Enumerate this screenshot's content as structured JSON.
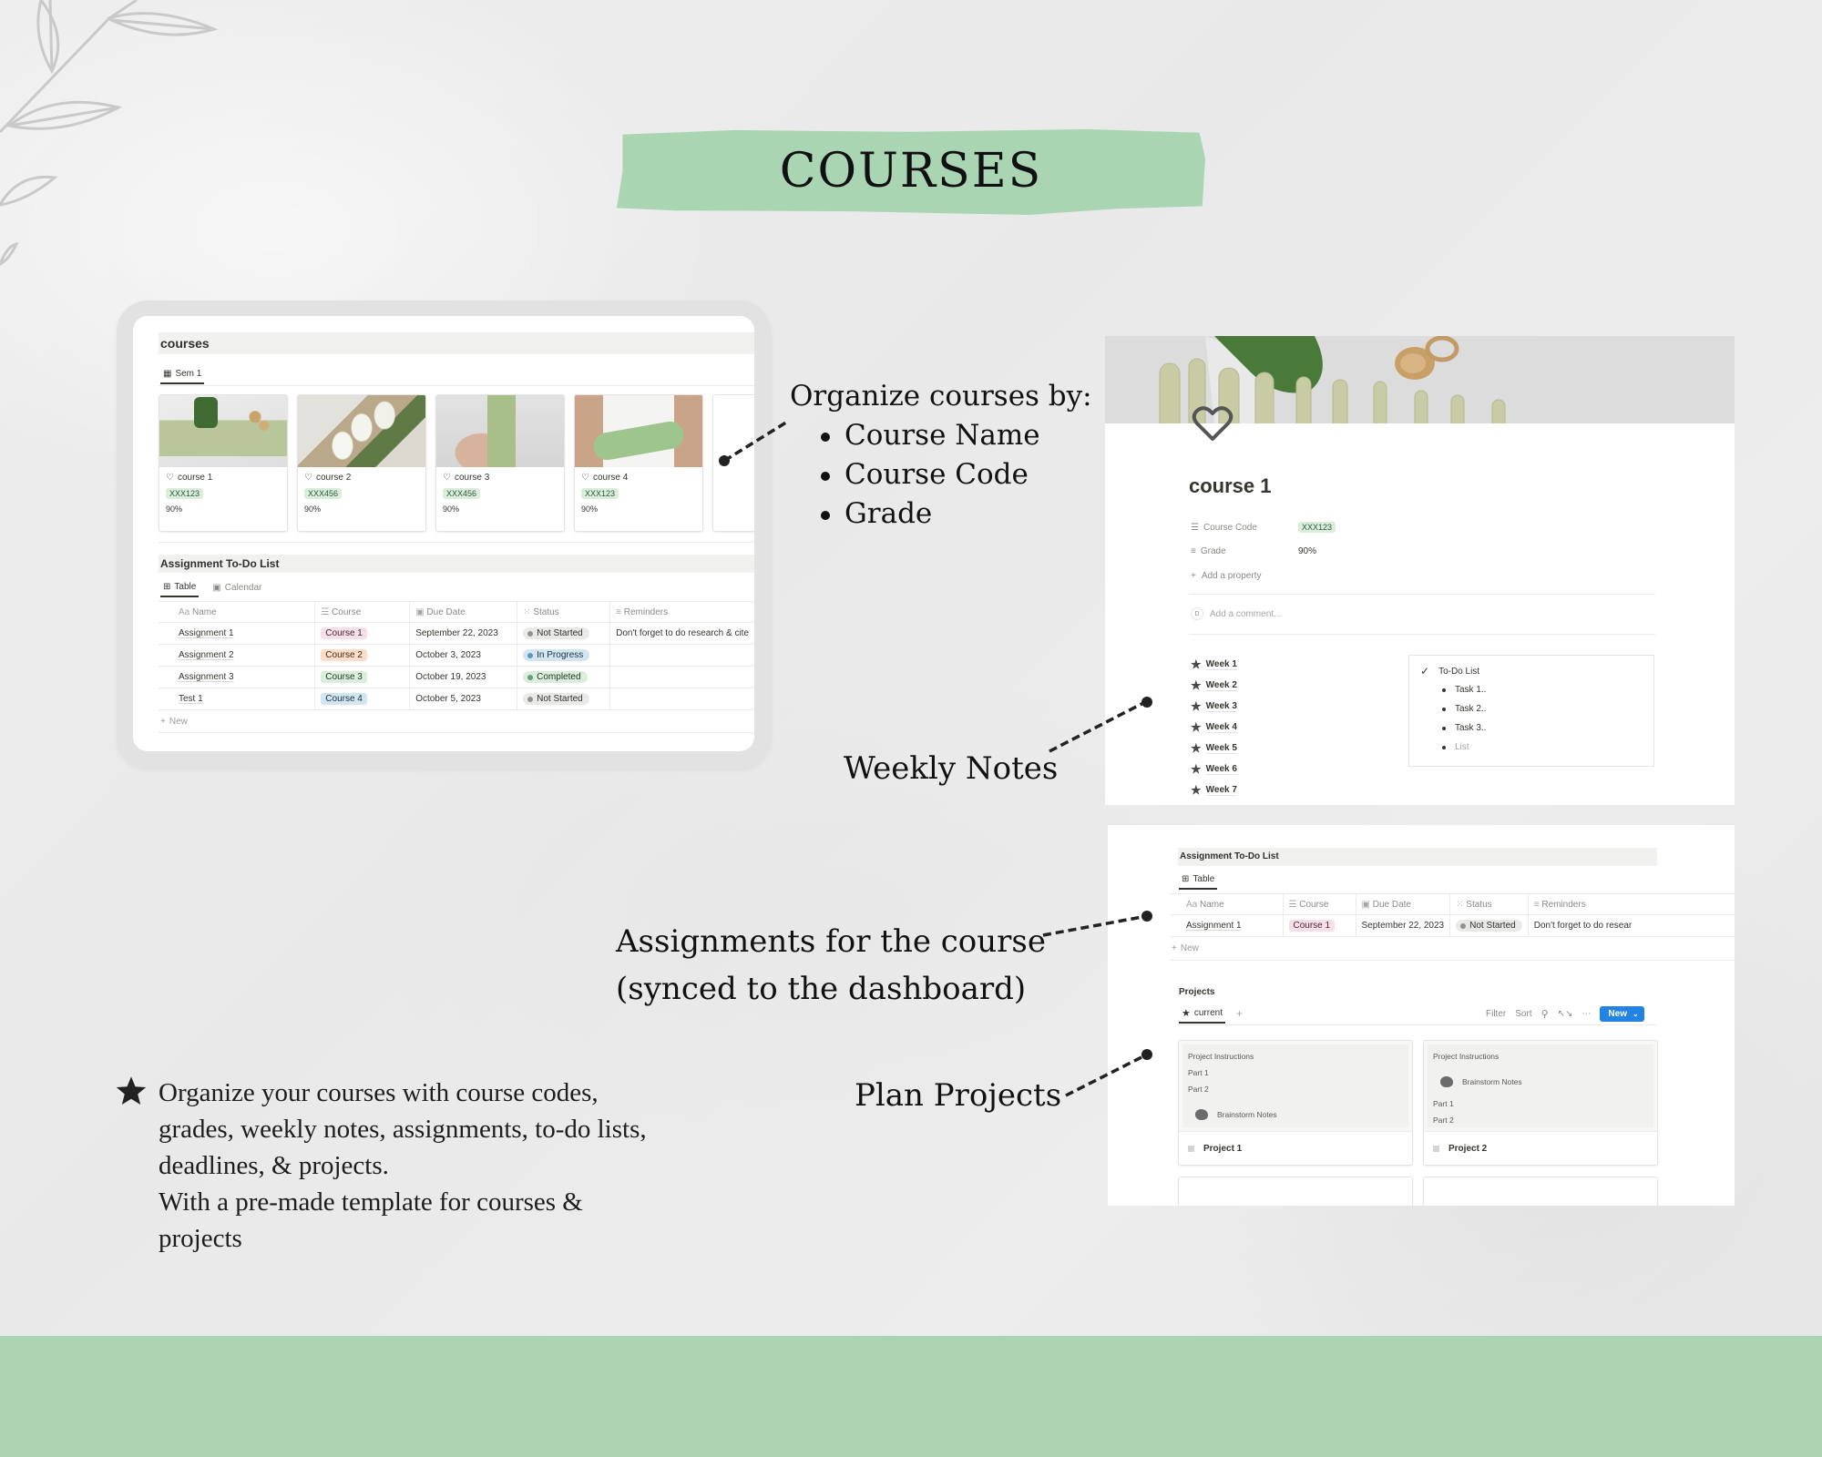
{
  "banner": {
    "title": "COURSES",
    "color": "#aad5b3"
  },
  "annotations": {
    "organize_heading": "Organize courses by:",
    "organize_items": [
      "Course Name",
      "Course Code",
      "Grade"
    ],
    "weekly_notes": "Weekly Notes",
    "assignments_line1": "Assignments for the course",
    "assignments_line2": "(synced to the dashboard)",
    "plan_projects": "Plan Projects",
    "bottom_lines": [
      "Organize your courses with course codes,",
      "grades, weekly notes, assignments, to-do lists,",
      "deadlines, & projects.",
      "With a pre-made template for courses &",
      "projects"
    ]
  },
  "dashboard": {
    "courses_title": "courses",
    "view_tab": "Sem 1",
    "cards": [
      {
        "name": "course 1",
        "code": "XXX123",
        "grade": "90%"
      },
      {
        "name": "course 2",
        "code": "XXX456",
        "grade": "90%"
      },
      {
        "name": "course 3",
        "code": "XXX456",
        "grade": "90%"
      },
      {
        "name": "course 4",
        "code": "XXX123",
        "grade": "90%"
      }
    ],
    "todo_title": "Assignment To-Do List",
    "todo_tabs": [
      "Table",
      "Calendar"
    ],
    "columns": [
      "Name",
      "Course",
      "Due Date",
      "Status",
      "Reminders"
    ],
    "column_prefix_name": "Aa",
    "rows": [
      {
        "name": "Assignment 1",
        "course": "Course 1",
        "due": "September 22, 2023",
        "status": "Not Started",
        "reminder": "Don't forget to do research & cite"
      },
      {
        "name": "Assignment 2",
        "course": "Course 2",
        "due": "October 3, 2023",
        "status": "In Progress",
        "reminder": ""
      },
      {
        "name": "Assignment 3",
        "course": "Course 3",
        "due": "October 19, 2023",
        "status": "Completed",
        "reminder": ""
      },
      {
        "name": "Test 1",
        "course": "Course 4",
        "due": "October 5, 2023",
        "status": "Not Started",
        "reminder": ""
      }
    ],
    "new_label": "New"
  },
  "course_page": {
    "title": "course 1",
    "properties": [
      {
        "label": "Course Code",
        "value": "XXX123"
      },
      {
        "label": "Grade",
        "value": "90%"
      }
    ],
    "add_property": "Add a property",
    "comment_avatar": "D",
    "comment_placeholder": "Add a comment...",
    "weeks": [
      "Week 1",
      "Week 2",
      "Week 3",
      "Week 4",
      "Week 5",
      "Week 6",
      "Week 7"
    ],
    "todo": {
      "title": "To-Do List",
      "items": [
        "Task 1..",
        "Task 2..",
        "Task 3.."
      ],
      "placeholder": "List"
    }
  },
  "course_assignments": {
    "title": "Assignment To-Do List",
    "tab": "Table",
    "columns": [
      "Name",
      "Course",
      "Due Date",
      "Status",
      "Reminders"
    ],
    "row": {
      "name": "Assignment 1",
      "course": "Course 1",
      "due": "September 22, 2023",
      "status": "Not Started",
      "reminder": "Don't forget to do resear"
    },
    "new_label": "New",
    "projects_title": "Projects",
    "projects_tab": "current",
    "toolbar": {
      "filter": "Filter",
      "sort": "Sort",
      "new": "New"
    },
    "project_cards": [
      {
        "preview": [
          "Project Instructions",
          "Part 1",
          "Part 2"
        ],
        "brainstorm": "Brainstorm Notes",
        "name": "Project 1"
      },
      {
        "preview_top": "Project Instructions",
        "brainstorm": "Brainstorm Notes",
        "preview_bottom": [
          "Part 1",
          "Part 2"
        ],
        "name": "Project 2"
      }
    ]
  },
  "colors": {
    "footer": "#acd4b3",
    "notion_blue": "#2383e2"
  }
}
